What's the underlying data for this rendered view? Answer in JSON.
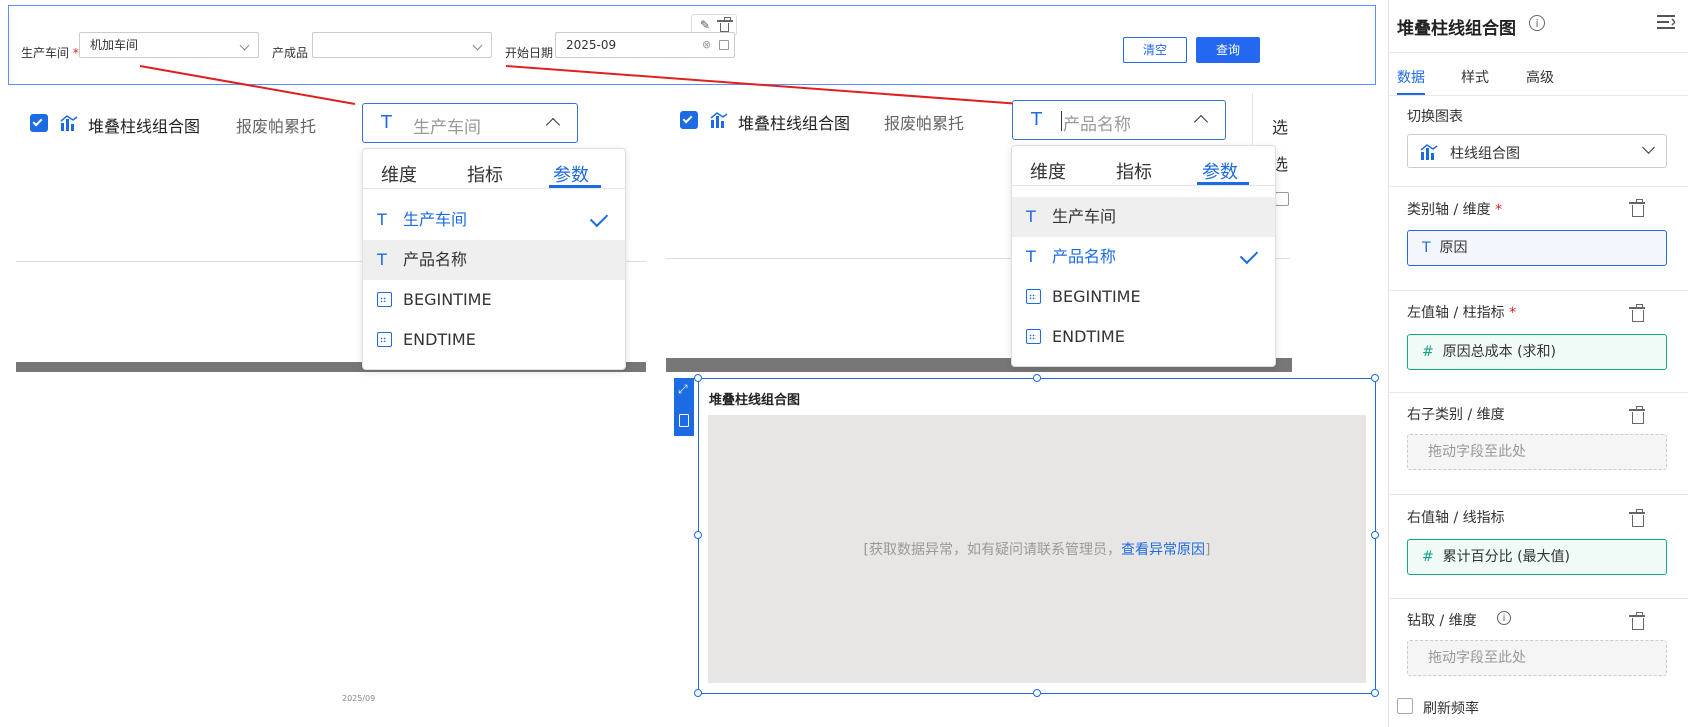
{
  "filters": {
    "workshop_label": "生产车间",
    "workshop_required": "*",
    "workshop_value": "机加车间",
    "product_label": "产成品",
    "product_value": "",
    "start_label": "开始日期",
    "start_value": "2025-09",
    "clear_label": "清空",
    "query_label": "查询"
  },
  "widget_left": {
    "chart_type_label": "堆叠柱线组合图",
    "component_name": "报废帕累托",
    "combo_value": "生产车间",
    "dropdown": {
      "tabs": [
        "维度",
        "指标",
        "参数"
      ],
      "active_tab": "参数",
      "items": [
        {
          "icon": "T",
          "label": "生产车间",
          "selected": true
        },
        {
          "icon": "T",
          "label": "产品名称",
          "selected": false
        },
        {
          "icon": "calendar",
          "label": "BEGINTIME",
          "selected": false
        },
        {
          "icon": "calendar",
          "label": "ENDTIME",
          "selected": false
        }
      ]
    },
    "bottom_text": "2025/09"
  },
  "widget_right": {
    "chart_type_label": "堆叠柱线组合图",
    "component_name": "报废帕累托",
    "combo_placeholder": "产品名称",
    "side_text_1": "选",
    "side_text_2": "选",
    "dropdown": {
      "tabs": [
        "维度",
        "指标",
        "参数"
      ],
      "active_tab": "参数",
      "items": [
        {
          "icon": "T",
          "label": "生产车间",
          "selected": false
        },
        {
          "icon": "T",
          "label": "产品名称",
          "selected": true
        },
        {
          "icon": "calendar",
          "label": "BEGINTIME",
          "selected": false
        },
        {
          "icon": "calendar",
          "label": "ENDTIME",
          "selected": false
        }
      ]
    }
  },
  "chart_widget": {
    "title": "堆叠柱线组合图",
    "error_prefix": "[获取数据异常，如有疑问请联系管理员，",
    "error_link": "查看异常原因",
    "error_suffix": "]"
  },
  "panel": {
    "title": "堆叠柱线组合图",
    "tabs": [
      "数据",
      "样式",
      "高级"
    ],
    "active_tab": "数据",
    "switch_chart_label": "切换图表",
    "switch_chart_value": "柱线组合图",
    "category_axis_label": "类别轴 / 维度",
    "category_axis_value": "原因",
    "left_axis_label": "左值轴 / 柱指标",
    "left_axis_value": "原因总成本 (求和)",
    "right_sub_label": "右子类别 / 维度",
    "right_sub_placeholder": "拖动字段至此处",
    "right_axis_label": "右值轴 / 线指标",
    "right_axis_value": "累计百分比 (最大值)",
    "drill_label": "钻取 / 维度",
    "drill_placeholder": "拖动字段至此处",
    "refresh_label": "刷新频率",
    "required_mark": "*"
  },
  "colors": {
    "accent": "#1d6be3",
    "annotation_red": "#e02020",
    "measure_green": "#17a589"
  }
}
